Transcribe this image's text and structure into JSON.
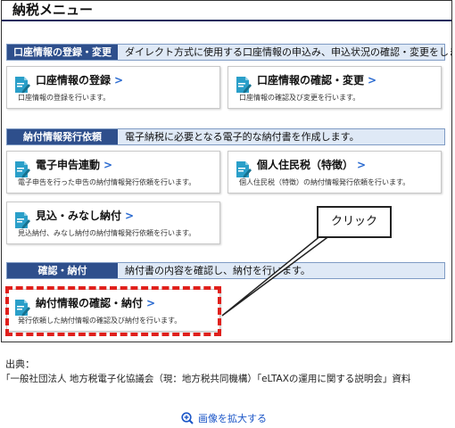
{
  "menu": {
    "title": "納税メニュー",
    "sections": [
      {
        "label": "口座情報の登録・変更",
        "description": "ダイレクト方式に使用する口座情報の申込み、申込状況の確認・変更をします。",
        "cards": [
          {
            "title": "口座情報の登録",
            "description": "口座情報の登録を行います。",
            "icon": "document-pen-icon"
          },
          {
            "title": "口座情報の確認・変更",
            "description": "口座情報の確認及び変更を行います。",
            "icon": "document-pen-icon"
          }
        ]
      },
      {
        "label": "納付情報発行依頼",
        "description": "電子納税に必要となる電子的な納付書を作成します。",
        "cards": [
          {
            "title": "電子申告連動",
            "description": "電子申告を行った申告の納付情報発行依頼を行います。",
            "icon": "document-pen-icon"
          },
          {
            "title": "個人住民税（特徴）",
            "description": "個人住民税（特徴）の納付情報発行依頼を行います。",
            "icon": "document-pen-icon"
          },
          {
            "title": "見込・みなし納付",
            "description": "見込納付、みなし納付の納付情報発行依頼を行います。",
            "icon": "document-pen-icon"
          }
        ]
      },
      {
        "label": "確認・納付",
        "description": "納付書の内容を確認し、納付を行います。",
        "cards": [
          {
            "title": "納付情報の確認・納付",
            "description": "発行依頼した納付情報の確認及び納付を行います。",
            "icon": "document-pen-icon"
          }
        ]
      }
    ],
    "chevron": ">"
  },
  "annotation": {
    "callout_text": "クリック",
    "highlight_color": "#e0201c"
  },
  "source": {
    "label": "出典：",
    "text": "「一般社団法人 地方税電子化協議会（現：地方税共同機構）「eLTAXの運用に関する説明会」資料"
  },
  "zoom_link": {
    "label": "画像を拡大する",
    "icon": "zoom-in-icon"
  },
  "colors": {
    "section_label_bg": "#2e4f8c",
    "section_bar_bg": "#dfe9f6",
    "icon_color": "#2a9fc9",
    "link_color": "#1a55c7"
  }
}
